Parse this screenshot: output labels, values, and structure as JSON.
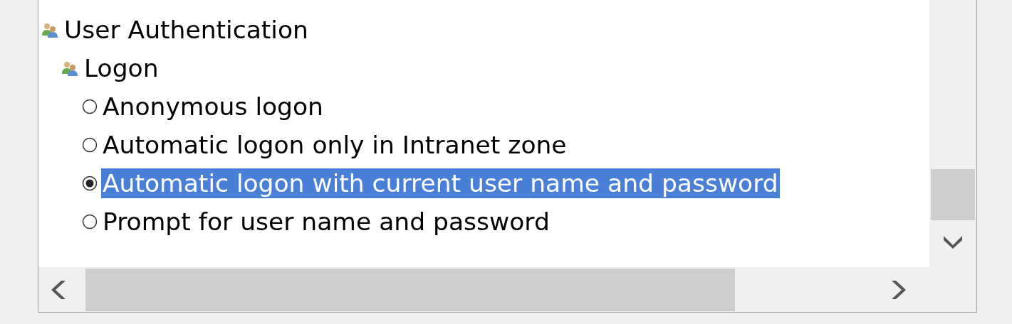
{
  "tree": [
    {
      "kind": "group",
      "label": "User Authentication",
      "children": [
        {
          "kind": "group",
          "label": "Logon",
          "children": [
            {
              "kind": "radio",
              "label": "Anonymous logon",
              "selected": false
            },
            {
              "kind": "radio",
              "label": "Automatic logon only in Intranet zone",
              "selected": false
            },
            {
              "kind": "radio",
              "label": "Automatic logon with current user name and password",
              "selected": true
            },
            {
              "kind": "radio",
              "label": "Prompt for user name and password",
              "selected": false
            }
          ]
        }
      ]
    }
  ]
}
